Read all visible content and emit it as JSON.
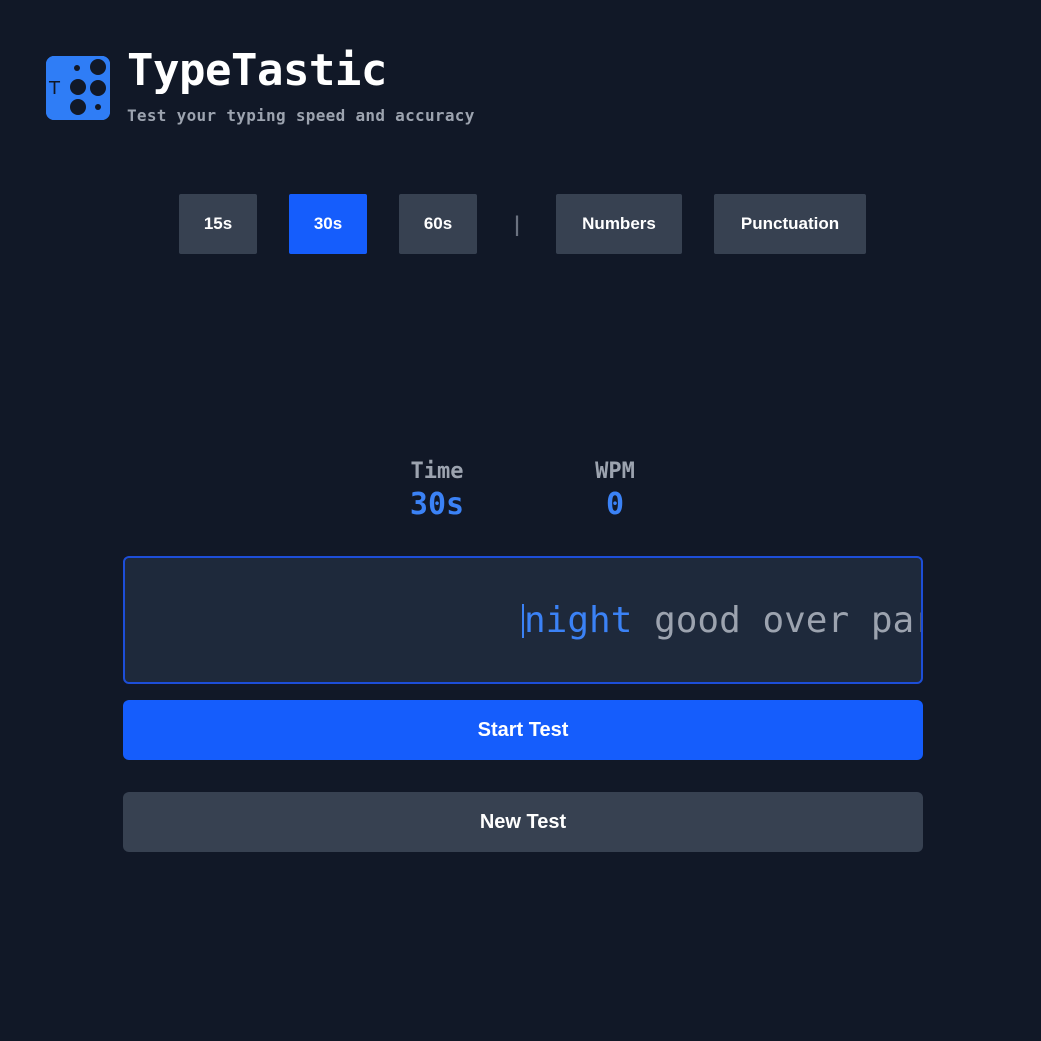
{
  "header": {
    "logo_letter": "T",
    "title": "TypeTastic",
    "subtitle": "Test your typing speed and accuracy"
  },
  "options": {
    "durations": [
      {
        "label": "15s",
        "active": false
      },
      {
        "label": "30s",
        "active": true
      },
      {
        "label": "60s",
        "active": false
      }
    ],
    "divider": "|",
    "toggles": [
      {
        "label": "Numbers",
        "active": false
      },
      {
        "label": "Punctuation",
        "active": false
      }
    ]
  },
  "stats": {
    "time_label": "Time",
    "time_value": "30s",
    "wpm_label": "WPM",
    "wpm_value": "0"
  },
  "typing": {
    "current_word": "night",
    "upcoming_words": [
      "good",
      "over",
      "par"
    ]
  },
  "actions": {
    "start_label": "Start Test",
    "new_label": "New Test"
  },
  "colors": {
    "background": "#111827",
    "accent": "#155dfc",
    "accent_text": "#3b82f6",
    "button_secondary": "#374151",
    "muted_text": "#9ca3af",
    "typing_bg": "#1e293b"
  }
}
